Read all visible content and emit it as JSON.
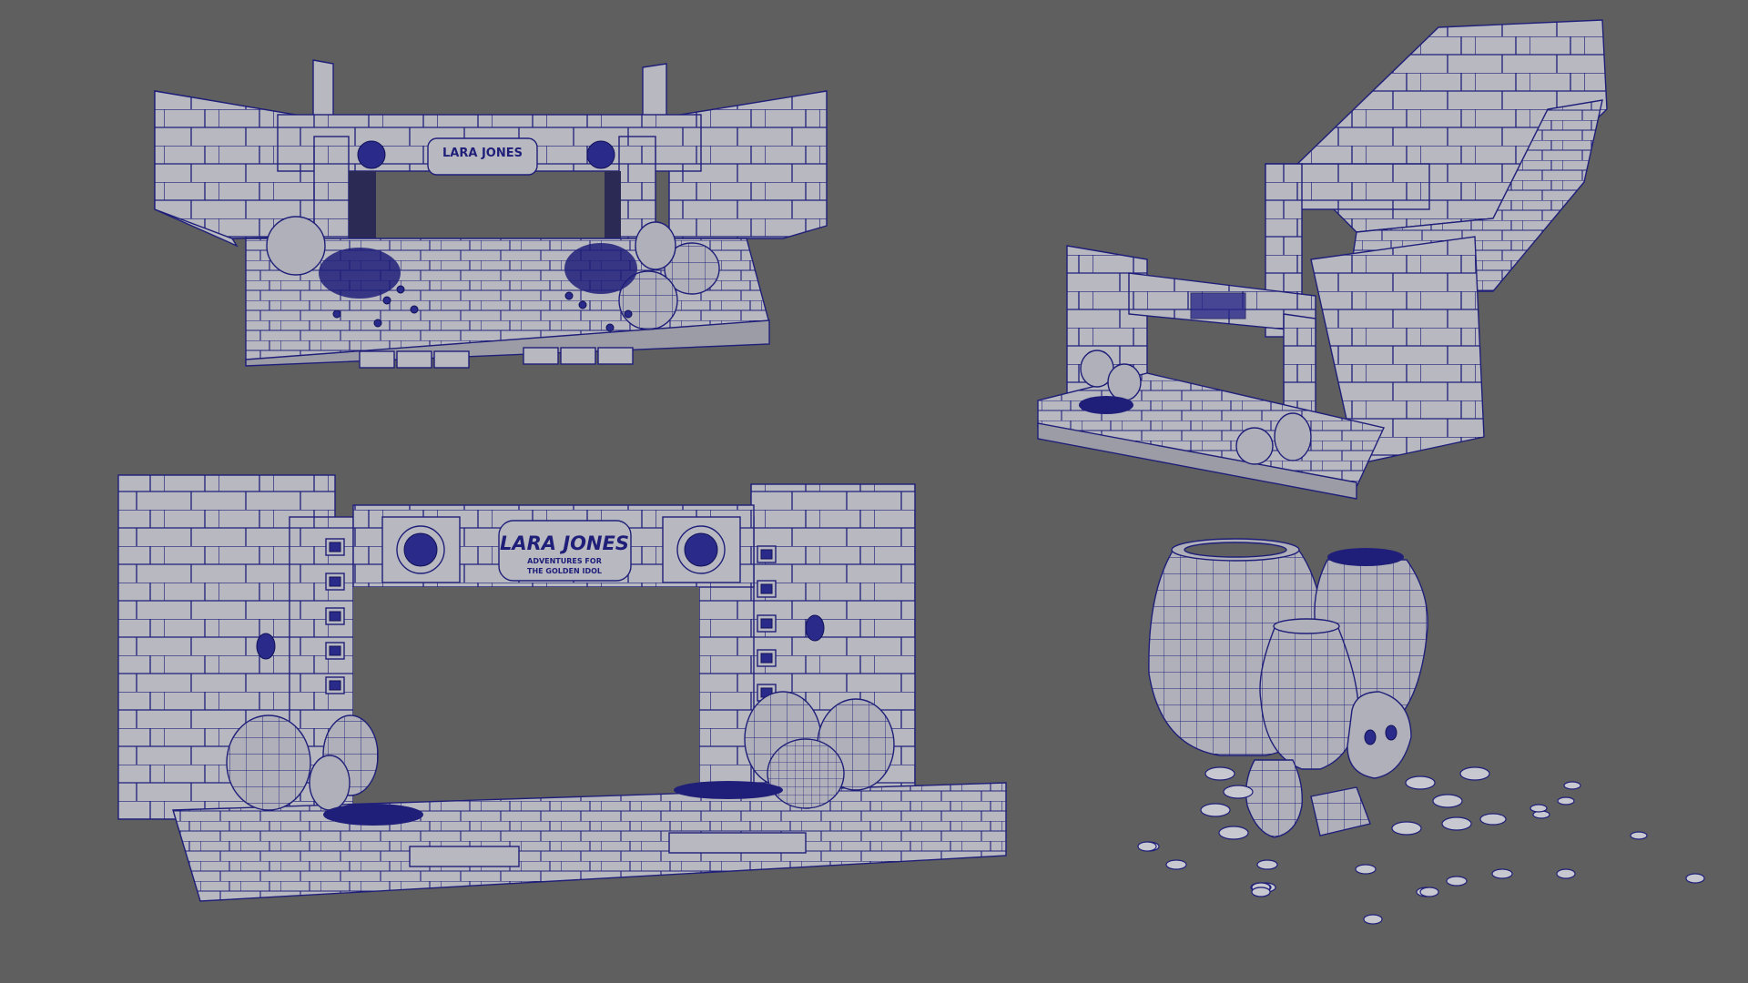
{
  "viewport": {
    "background": "#5f5f5f",
    "wire_color": "#1f1f7a",
    "surface_color": "#b8b8c0"
  },
  "views": [
    {
      "name": "front-perspective-view"
    },
    {
      "name": "corridor-perspective-view"
    },
    {
      "name": "front-orthographic-view"
    },
    {
      "name": "props-closeup-view"
    }
  ],
  "banner": {
    "title": "LARA JONES",
    "subtitle_line1": "ADVENTURES FOR",
    "subtitle_line2": "THE GOLDEN IDOL"
  }
}
